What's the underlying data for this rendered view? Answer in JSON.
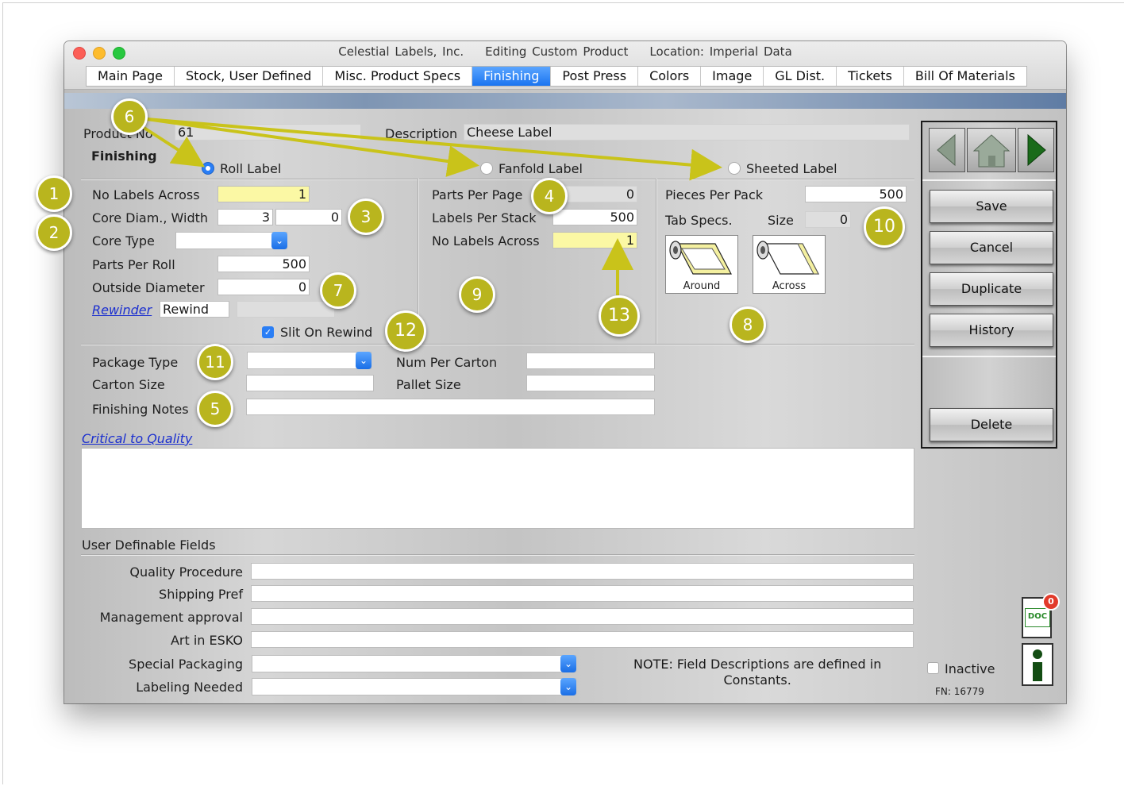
{
  "window": {
    "title": "Celestial Labels, Inc.    Editing Custom Product    Location: Imperial Data"
  },
  "tabs": [
    "Main Page",
    "Stock, User Defined",
    "Misc. Product Specs",
    "Finishing",
    "Post Press",
    "Colors",
    "Image",
    "GL Dist.",
    "Tickets",
    "Bill Of Materials"
  ],
  "active_tab": "Finishing",
  "header": {
    "product_no_label": "Product No",
    "product_no_value": "61",
    "description_label": "Description",
    "description_value": "Cheese Label",
    "finishing_label": "Finishing"
  },
  "label_types": {
    "roll": "Roll Label",
    "fanfold": "Fanfold Label",
    "sheeted": "Sheeted Label",
    "selected": "Roll Label"
  },
  "roll": {
    "no_labels_across_label": "No Labels Across",
    "no_labels_across_value": "1",
    "core_diam_label": "Core Diam., Width",
    "core_diam_value": "3",
    "core_width_value": "0",
    "core_type_label": "Core Type",
    "core_type_value": "",
    "parts_per_roll_label": "Parts Per Roll",
    "parts_per_roll_value": "500",
    "outside_diameter_label": "Outside Diameter",
    "outside_diameter_value": "0",
    "rewinder_link": "Rewinder",
    "rewinder_value": "Rewind",
    "slit_on_rewind_label": "Slit On Rewind",
    "slit_on_rewind_checked": true
  },
  "fanfold": {
    "parts_per_page_label": "Parts Per Page",
    "parts_per_page_value": "0",
    "labels_per_stack_label": "Labels Per Stack",
    "labels_per_stack_value": "500",
    "no_labels_across_label": "No Labels Across",
    "no_labels_across_value": "1"
  },
  "sheeted": {
    "pieces_per_pack_label": "Pieces Per Pack",
    "pieces_per_pack_value": "500",
    "tab_specs_label": "Tab Specs.",
    "size_label": "Size",
    "size_value": "0",
    "around_label": "Around",
    "across_label": "Across"
  },
  "packaging": {
    "package_type_label": "Package Type",
    "package_type_value": "",
    "carton_size_label": "Carton Size",
    "carton_size_value": "",
    "num_per_carton_label": "Num Per Carton",
    "num_per_carton_value": "",
    "pallet_size_label": "Pallet Size",
    "pallet_size_value": "",
    "finishing_notes_label": "Finishing Notes",
    "finishing_notes_value": ""
  },
  "critical_to_quality_link": "Critical to Quality",
  "user_fields": {
    "title": "User Definable Fields",
    "fields": [
      {
        "label": "Quality Procedure",
        "value": ""
      },
      {
        "label": "Shipping Pref",
        "value": ""
      },
      {
        "label": "Management approval",
        "value": ""
      },
      {
        "label": "Art in ESKO",
        "value": ""
      },
      {
        "label": "Special Packaging",
        "value": ""
      },
      {
        "label": "Labeling Needed",
        "value": ""
      }
    ],
    "note_line1": "NOTE:  Field Descriptions are defined in",
    "note_line2": "Constants."
  },
  "sidebar": {
    "save": "Save",
    "cancel": "Cancel",
    "duplicate": "Duplicate",
    "history": "History",
    "delete": "Delete"
  },
  "footer": {
    "inactive_label": "Inactive",
    "inactive_checked": false,
    "doc_count": "0",
    "doc_label": "DOC",
    "fn": "FN: 16779"
  },
  "annotations": [
    "1",
    "2",
    "3",
    "4",
    "5",
    "6",
    "7",
    "8",
    "9",
    "10",
    "11",
    "12",
    "13"
  ],
  "colors": {
    "accent": "#2a7ef5",
    "badge": "#b9b51e",
    "highlight_field": "#fbf8a4",
    "arrow": "#c9c31a"
  }
}
